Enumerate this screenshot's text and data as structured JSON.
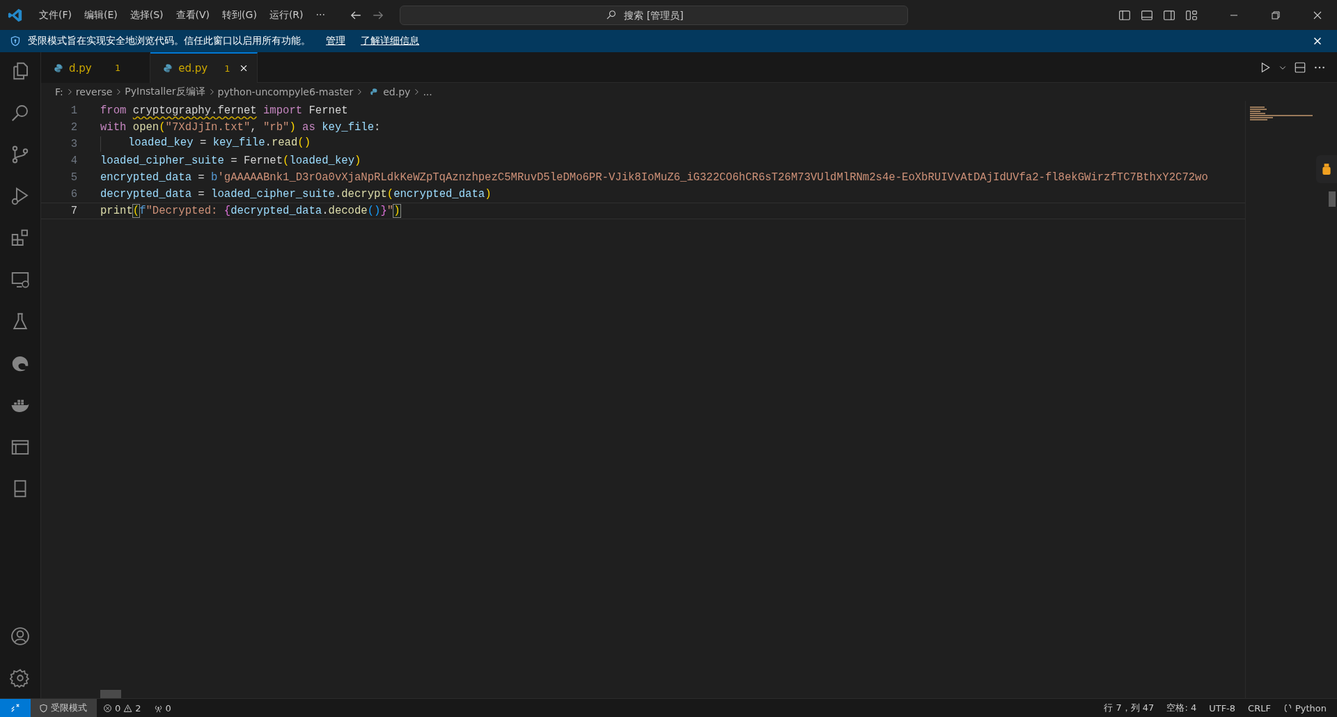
{
  "menu": [
    "文件(F)",
    "编辑(E)",
    "选择(S)",
    "查看(V)",
    "转到(G)",
    "运行(R)",
    "···"
  ],
  "search": {
    "placeholder": "搜索 [管理员]"
  },
  "banner": {
    "text": "受限模式旨在实现安全地浏览代码。信任此窗口以启用所有功能。",
    "links": [
      "管理",
      "了解详细信息"
    ]
  },
  "activity_bar": [
    {
      "kind": "files"
    },
    {
      "kind": "search"
    },
    {
      "kind": "scm"
    },
    {
      "kind": "debug"
    },
    {
      "kind": "extensions"
    },
    {
      "kind": "remote"
    },
    {
      "kind": "testing"
    },
    {
      "kind": "edge"
    },
    {
      "kind": "docker"
    },
    {
      "kind": "panel"
    },
    {
      "kind": "device"
    }
  ],
  "activity_bottom": [
    {
      "kind": "account"
    },
    {
      "kind": "settings"
    }
  ],
  "tabs": [
    {
      "label": "d.py",
      "badge": "1",
      "selected": false
    },
    {
      "label": "ed.py",
      "badge": "1",
      "selected": true
    }
  ],
  "breadcrumbs": [
    "F:",
    "reverse",
    "PyInstaller反编译",
    "python-uncompyle6-master",
    "ed.py",
    "..."
  ],
  "lines": [
    {
      "number": "1",
      "current": false,
      "tokens": [
        {
          "text": "from ",
          "kind": "keyword"
        },
        {
          "text": "cryptography.fernet",
          "kind": "plain",
          "warning": true
        },
        {
          "text": " import",
          "kind": "keyword"
        },
        {
          "text": " Fernet",
          "kind": "plain"
        }
      ]
    },
    {
      "number": "2",
      "current": false,
      "tokens": [
        {
          "text": "with ",
          "kind": "keyword"
        },
        {
          "text": "open",
          "kind": "func"
        },
        {
          "text": "(",
          "kind": "bracket1"
        },
        {
          "text": "\"7XdJjIn.txt\"",
          "kind": "string"
        },
        {
          "text": ", ",
          "kind": "plain"
        },
        {
          "text": "\"rb\"",
          "kind": "string"
        },
        {
          "text": ")",
          "kind": "bracket1"
        },
        {
          "text": " as ",
          "kind": "keyword"
        },
        {
          "text": "key_file",
          "kind": "var"
        },
        {
          "text": ":",
          "kind": "plain"
        }
      ]
    },
    {
      "number": "3",
      "current": false,
      "indent": true,
      "tokens": [
        {
          "text": "loaded_key",
          "kind": "var"
        },
        {
          "text": " = ",
          "kind": "plain"
        },
        {
          "text": "key_file",
          "kind": "var"
        },
        {
          "text": ".",
          "kind": "plain"
        },
        {
          "text": "read",
          "kind": "func"
        },
        {
          "text": "()",
          "kind": "bracket1"
        }
      ]
    },
    {
      "number": "4",
      "current": false,
      "tokens": [
        {
          "text": "loaded_cipher_suite",
          "kind": "var"
        },
        {
          "text": " = ",
          "kind": "plain"
        },
        {
          "text": "Fernet",
          "kind": "plain"
        },
        {
          "text": "(",
          "kind": "bracket1"
        },
        {
          "text": "loaded_key",
          "kind": "var"
        },
        {
          "text": ")",
          "kind": "bracket1"
        }
      ]
    },
    {
      "number": "5",
      "current": false,
      "tokens": [
        {
          "text": "encrypted_data",
          "kind": "var"
        },
        {
          "text": " = ",
          "kind": "plain"
        },
        {
          "text": "b",
          "kind": "storage"
        },
        {
          "text": "'gAAAAABnk1_D3rOa0vXjaNpRLdkKeWZpTqAznzhpezC5MRuvD5leDMo6PR-VJik8IoMuZ6_iG322CO6hCR6sT26M73VUldMlRNm2s4e-EoXbRUIVvAtDAjIdUVfa2-fl8ekGWirzfTC7BthxY2C72wo",
          "kind": "string"
        }
      ]
    },
    {
      "number": "6",
      "current": false,
      "tokens": [
        {
          "text": "decrypted_data",
          "kind": "var"
        },
        {
          "text": " = ",
          "kind": "plain"
        },
        {
          "text": "loaded_cipher_suite",
          "kind": "var"
        },
        {
          "text": ".",
          "kind": "plain"
        },
        {
          "text": "decrypt",
          "kind": "func"
        },
        {
          "text": "(",
          "kind": "bracket1"
        },
        {
          "text": "encrypted_data",
          "kind": "var"
        },
        {
          "text": ")",
          "kind": "bracket1"
        }
      ]
    },
    {
      "number": "7",
      "current": true,
      "tokens": [
        {
          "text": "print",
          "kind": "func"
        },
        {
          "text": "(",
          "kind": "bracket1",
          "matched": true
        },
        {
          "text": "f",
          "kind": "storage"
        },
        {
          "text": "\"Decrypted: ",
          "kind": "string"
        },
        {
          "text": "{",
          "kind": "bracket2"
        },
        {
          "text": "decrypted_data",
          "kind": "var"
        },
        {
          "text": ".",
          "kind": "plain"
        },
        {
          "text": "decode",
          "kind": "func"
        },
        {
          "text": "()",
          "kind": "bracket3"
        },
        {
          "text": "}",
          "kind": "bracket2"
        },
        {
          "text": "\"",
          "kind": "string"
        },
        {
          "text": ")",
          "kind": "bracket1",
          "matched": true
        }
      ]
    }
  ],
  "status_bar": {
    "mode": "受限模式",
    "errors": "0",
    "warnings": "2",
    "ports": "0",
    "right": [
      "行 7，列 47",
      "空格: 4",
      "UTF-8",
      "CRLF",
      "Python"
    ]
  }
}
